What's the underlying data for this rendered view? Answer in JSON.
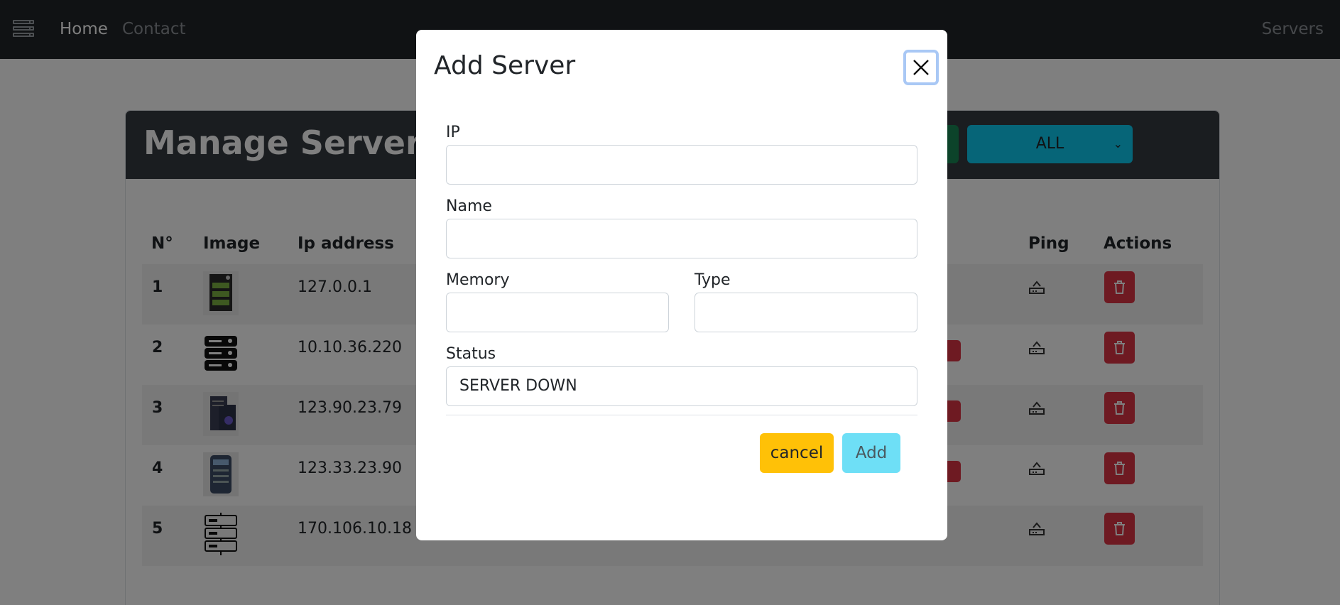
{
  "navbar": {
    "home": "Home",
    "contact": "Contact",
    "servers": "Servers"
  },
  "page": {
    "title": "Manage Servers",
    "filter_value": "ALL",
    "columns": [
      "N°",
      "Image",
      "Ip address",
      "Ping",
      "Actions"
    ],
    "rows": [
      {
        "n": "1",
        "ip": "127.0.0.1"
      },
      {
        "n": "2",
        "ip": "10.10.36.220"
      },
      {
        "n": "3",
        "ip": "123.90.23.79"
      },
      {
        "n": "4",
        "ip": "123.33.23.90"
      },
      {
        "n": "5",
        "ip": "170.106.10.18"
      }
    ]
  },
  "modal": {
    "title": "Add Server",
    "fields": {
      "ip_label": "IP",
      "ip_value": "",
      "name_label": "Name",
      "name_value": "",
      "memory_label": "Memory",
      "memory_value": "",
      "type_label": "Type",
      "type_value": "",
      "status_label": "Status",
      "status_value": "SERVER DOWN"
    },
    "cancel_label": "cancel",
    "add_label": "Add"
  },
  "colors": {
    "navbar": "#212529",
    "header": "#343a40",
    "danger": "#dc3545",
    "warning": "#ffc107",
    "info": "#0dcaf0"
  },
  "icons": [
    "menu-icon",
    "server-icon",
    "ping-icon",
    "trash-icon",
    "close-icon",
    "chevron-down-icon"
  ]
}
